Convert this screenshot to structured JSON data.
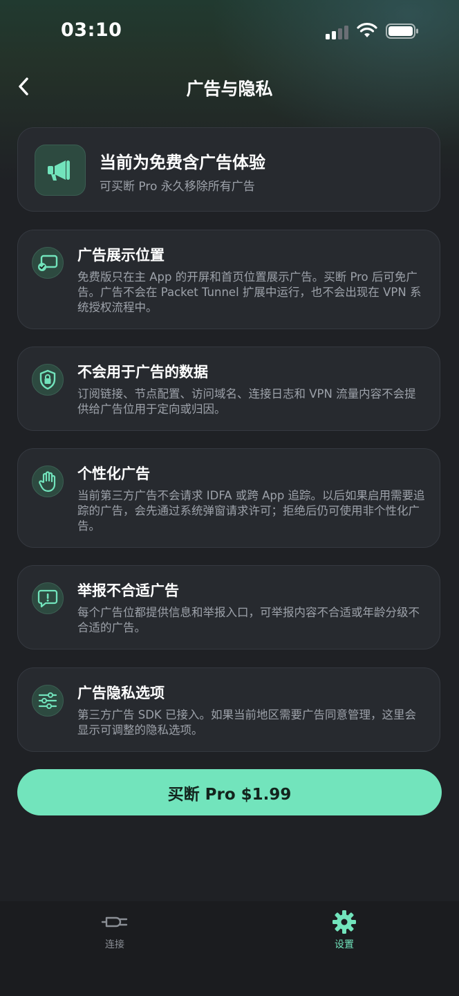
{
  "status_bar": {
    "time": "03:10"
  },
  "nav": {
    "title": "广告与隐私"
  },
  "hero": {
    "title": "当前为免费含广告体验",
    "subtitle": "可买断 Pro 永久移除所有广告",
    "icon": "megaphone-icon"
  },
  "cards": [
    {
      "icon": "screen-check-icon",
      "title": "广告展示位置",
      "body": "免费版只在主 App 的开屏和首页位置展示广告。买断 Pro 后可免广告。广告不会在 Packet Tunnel 扩展中运行，也不会出现在 VPN 系统授权流程中。"
    },
    {
      "icon": "shield-lock-icon",
      "title": "不会用于广告的数据",
      "body": "订阅链接、节点配置、访问域名、连接日志和 VPN 流量内容不会提供给广告位用于定向或归因。"
    },
    {
      "icon": "hand-icon",
      "title": "个性化广告",
      "body": "当前第三方广告不会请求 IDFA 或跨 App 追踪。以后如果启用需要追踪的广告，会先通过系统弹窗请求许可；拒绝后仍可使用非个性化广告。"
    },
    {
      "icon": "report-bubble-icon",
      "title": "举报不合适广告",
      "body": "每个广告位都提供信息和举报入口，可举报内容不合适或年龄分级不合适的广告。"
    },
    {
      "icon": "sliders-icon",
      "title": "广告隐私选项",
      "body": "第三方广告 SDK 已接入。如果当前地区需要广告同意管理，这里会显示可调整的隐私选项。"
    }
  ],
  "buy_button": {
    "label": "买断 Pro $1.99"
  },
  "tabbar": {
    "connect": {
      "label": "连接",
      "icon": "plug-icon"
    },
    "settings": {
      "label": "设置",
      "icon": "gear-icon",
      "active": true
    }
  },
  "colors": {
    "accent": "#72e4bc",
    "card_bg": "#272a2f",
    "page_bg": "#1f2125",
    "muted_text": "#9da2aa"
  }
}
